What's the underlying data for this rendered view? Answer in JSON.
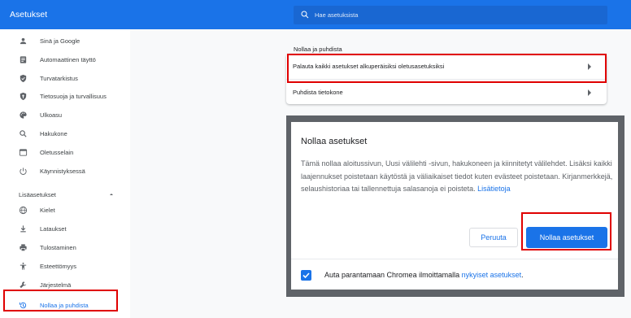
{
  "header": {
    "title": "Asetukset",
    "search_placeholder": "Hae asetuksista"
  },
  "sidebar": {
    "items": [
      {
        "label": "Sinä ja Google",
        "icon": "person-icon"
      },
      {
        "label": "Automaattinen täyttö",
        "icon": "autofill-icon"
      },
      {
        "label": "Turvatarkistus",
        "icon": "shield-check-icon"
      },
      {
        "label": "Tietosuoja ja turvallisuus",
        "icon": "privacy-shield-icon"
      },
      {
        "label": "Ulkoasu",
        "icon": "palette-icon"
      },
      {
        "label": "Hakukone",
        "icon": "search-icon"
      },
      {
        "label": "Oletusselain",
        "icon": "browser-icon"
      },
      {
        "label": "Käynnistyksessä",
        "icon": "power-icon"
      }
    ],
    "advanced_label": "Lisäasetukset",
    "advanced_items": [
      {
        "label": "Kielet",
        "icon": "globe-icon"
      },
      {
        "label": "Lataukset",
        "icon": "download-icon"
      },
      {
        "label": "Tulostaminen",
        "icon": "print-icon"
      },
      {
        "label": "Esteettömyys",
        "icon": "accessibility-icon"
      },
      {
        "label": "Järjestelmä",
        "icon": "wrench-icon"
      },
      {
        "label": "Nollaa ja puhdista",
        "icon": "restore-icon",
        "active": true
      }
    ]
  },
  "main": {
    "section_title": "Nollaa ja puhdista",
    "rows": [
      {
        "label": "Palauta kaikki asetukset alkuperäisiksi oletusasetuksiksi"
      },
      {
        "label": "Puhdista tietokone"
      }
    ]
  },
  "dialog": {
    "title": "Nollaa asetukset",
    "body": "Tämä nollaa aloitussivun, Uusi välilehti -sivun, hakukoneen ja kiinnitetyt välilehdet. Lisäksi kaikki laajennukset poistetaan käytöstä ja väliaikaiset tiedot kuten evästeet poistetaan. Kirjanmerkkejä, selaushistoriaa tai tallennettuja salasanoja ei poisteta.",
    "learn_more": "Lisätietoja",
    "cancel_label": "Peruuta",
    "reset_label": "Nollaa asetukset",
    "footer_text": "Auta parantamaan Chromea ilmoittamalla",
    "footer_link": "nykyiset asetukset",
    "footer_end": ".",
    "checkbox_checked": true
  },
  "colors": {
    "accent": "#1a73e8",
    "highlight": "#e00000"
  }
}
